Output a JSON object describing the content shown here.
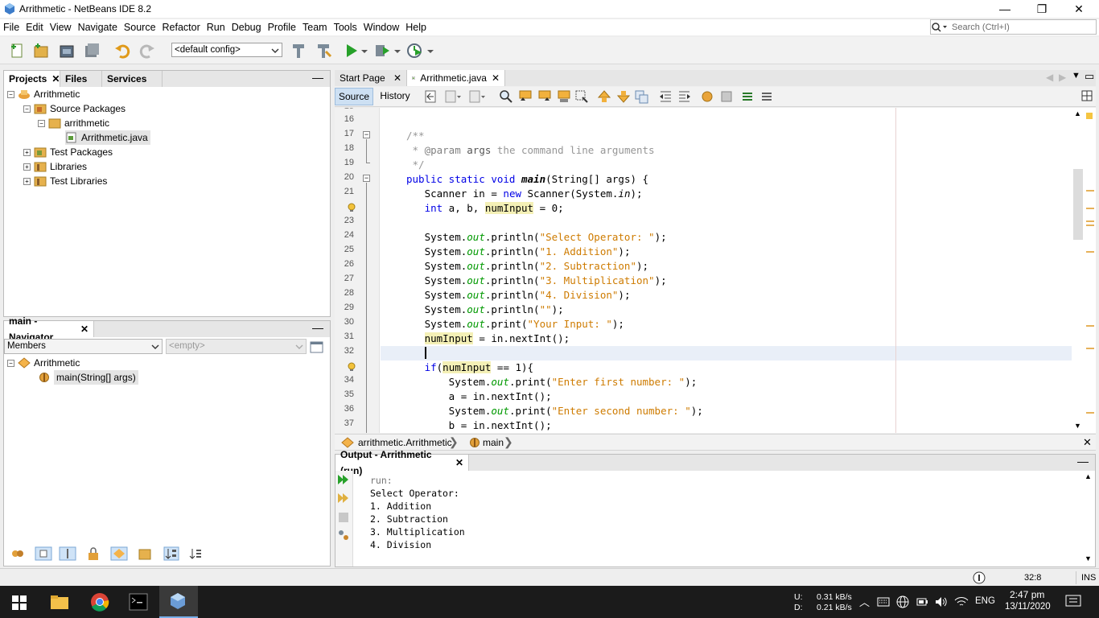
{
  "window": {
    "title": "Arrithmetic - NetBeans IDE 8.2",
    "minimize": "—",
    "maximize": "❐",
    "close": "✕"
  },
  "menu": [
    "File",
    "Edit",
    "View",
    "Navigate",
    "Source",
    "Refactor",
    "Run",
    "Debug",
    "Profile",
    "Team",
    "Tools",
    "Window",
    "Help"
  ],
  "search": {
    "placeholder": "Search (Ctrl+I)"
  },
  "toolbar": {
    "config": "<default config>"
  },
  "projects_panel": {
    "tabs": [
      "Projects",
      "Files",
      "Services"
    ],
    "tree": [
      {
        "label": "Arrithmetic",
        "icon": "project-icon"
      },
      {
        "label": "Source Packages",
        "icon": "source-packages-icon"
      },
      {
        "label": "arrithmetic",
        "icon": "package-icon"
      },
      {
        "label": "Arrithmetic.java",
        "icon": "java-file-icon"
      },
      {
        "label": "Test Packages",
        "icon": "test-packages-icon"
      },
      {
        "label": "Libraries",
        "icon": "libraries-icon"
      },
      {
        "label": "Test Libraries",
        "icon": "test-libraries-icon"
      }
    ]
  },
  "navigator_panel": {
    "title": "main - Navigator",
    "filter": "Members",
    "filter2": "<empty>",
    "tree": [
      {
        "label": "Arrithmetic"
      },
      {
        "label": "main(String[] args)"
      }
    ]
  },
  "editor": {
    "tabs": [
      "Start Page",
      "Arrithmetic.java"
    ],
    "modes": [
      "Source",
      "History"
    ],
    "line_numbers": [
      "16",
      "17",
      "18",
      "19",
      "20",
      "21",
      "22",
      "23",
      "24",
      "25",
      "26",
      "27",
      "28",
      "29",
      "30",
      "31",
      "32",
      "33",
      "34",
      "35",
      "36",
      "37"
    ],
    "breadcrumb": [
      "arrithmetic.Arrithmetic",
      "main"
    ]
  },
  "output": {
    "title": "Output - Arrithmetic (run)",
    "lines": [
      "run:",
      "Select Operator:",
      "1. Addition",
      "2. Subtraction",
      "3. Multiplication",
      "4. Division"
    ]
  },
  "status": {
    "position": "32:8",
    "mode": "INS"
  },
  "taskbar": {
    "net_up_label": "U:",
    "net_up": "0.31 kB/s",
    "net_down_label": "D:",
    "net_down": "0.21 kB/s",
    "lang": "ENG",
    "time": "2:47 pm",
    "date": "13/11/2020"
  }
}
